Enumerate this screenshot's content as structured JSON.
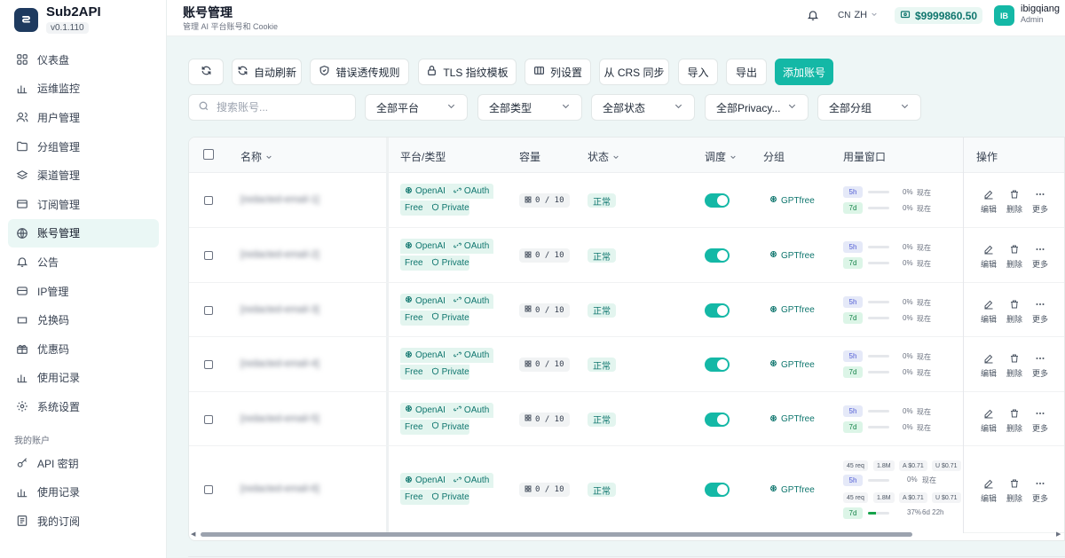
{
  "brand": {
    "name": "Sub2API",
    "version": "v0.1.110"
  },
  "nav": {
    "items": [
      {
        "label": "仪表盘",
        "icon": "grid-icon"
      },
      {
        "label": "运维监控",
        "icon": "bar-chart-icon"
      },
      {
        "label": "用户管理",
        "icon": "users-icon"
      },
      {
        "label": "分组管理",
        "icon": "folder-icon"
      },
      {
        "label": "渠道管理",
        "icon": "layers-icon"
      },
      {
        "label": "订阅管理",
        "icon": "card-icon"
      },
      {
        "label": "账号管理",
        "icon": "globe-icon",
        "active": true
      },
      {
        "label": "公告",
        "icon": "bell-icon"
      },
      {
        "label": "IP管理",
        "icon": "server-icon"
      },
      {
        "label": "兑换码",
        "icon": "ticket-icon"
      },
      {
        "label": "优惠码",
        "icon": "gift-icon"
      },
      {
        "label": "使用记录",
        "icon": "bar-chart-icon"
      },
      {
        "label": "系统设置",
        "icon": "gear-icon"
      }
    ],
    "section_label": "我的账户",
    "account_items": [
      {
        "label": "API 密钥",
        "icon": "key-icon"
      },
      {
        "label": "使用记录",
        "icon": "bar-chart-icon"
      },
      {
        "label": "我的订阅",
        "icon": "subscription-icon"
      }
    ]
  },
  "header": {
    "title": "账号管理",
    "subtitle": "管理 AI 平台账号和 Cookie",
    "lang_flag": "CN",
    "lang": "ZH",
    "balance": "$9999860.50",
    "avatar_initials": "IB",
    "username": "ibigqiang",
    "role": "Admin"
  },
  "toolbar": {
    "auto_refresh": "自动刷新",
    "error_rules": "错误透传规则",
    "tls_template": "TLS 指纹模板",
    "columns": "列设置",
    "crs_sync": "从 CRS 同步",
    "import": "导入",
    "export": "导出",
    "add_account": "添加账号"
  },
  "filters": {
    "search_placeholder": "搜索账号...",
    "platform": "全部平台",
    "type": "全部类型",
    "status": "全部状态",
    "privacy": "全部Privacy...",
    "group": "全部分组"
  },
  "table": {
    "headers": {
      "name": "名称",
      "platform_type": "平台/类型",
      "capacity": "容量",
      "status": "状态",
      "schedule": "调度",
      "group": "分组",
      "usage_window": "用量窗口",
      "actions": "操作"
    },
    "rows": [
      {
        "name": "[redacted-email-1]",
        "platform": "OpenAI",
        "auth": "OAuth",
        "plan": "Free",
        "privacy": "Private",
        "capacity": "0 / 10",
        "status": "正常",
        "scheduled": true,
        "group": "GPTfree",
        "windows": [
          {
            "label": "5h",
            "pct": "0%",
            "note": "现在",
            "fill": 0
          },
          {
            "label": "7d",
            "pct": "0%",
            "note": "现在",
            "fill": 0
          }
        ]
      },
      {
        "name": "[redacted-email-2]",
        "platform": "OpenAI",
        "auth": "OAuth",
        "plan": "Free",
        "privacy": "Private",
        "capacity": "0 / 10",
        "status": "正常",
        "scheduled": true,
        "group": "GPTfree",
        "windows": [
          {
            "label": "5h",
            "pct": "0%",
            "note": "现在",
            "fill": 0
          },
          {
            "label": "7d",
            "pct": "0%",
            "note": "现在",
            "fill": 0
          }
        ]
      },
      {
        "name": "[redacted-email-3]",
        "platform": "OpenAI",
        "auth": "OAuth",
        "plan": "Free",
        "privacy": "Private",
        "capacity": "0 / 10",
        "status": "正常",
        "scheduled": true,
        "group": "GPTfree",
        "windows": [
          {
            "label": "5h",
            "pct": "0%",
            "note": "现在",
            "fill": 0
          },
          {
            "label": "7d",
            "pct": "0%",
            "note": "现在",
            "fill": 0
          }
        ]
      },
      {
        "name": "[redacted-email-4]",
        "platform": "OpenAI",
        "auth": "OAuth",
        "plan": "Free",
        "privacy": "Private",
        "capacity": "0 / 10",
        "status": "正常",
        "scheduled": true,
        "group": "GPTfree",
        "windows": [
          {
            "label": "5h",
            "pct": "0%",
            "note": "现在",
            "fill": 0
          },
          {
            "label": "7d",
            "pct": "0%",
            "note": "现在",
            "fill": 0
          }
        ]
      },
      {
        "name": "[redacted-email-5]",
        "platform": "OpenAI",
        "auth": "OAuth",
        "plan": "Free",
        "privacy": "Private",
        "capacity": "0 / 10",
        "status": "正常",
        "scheduled": true,
        "group": "GPTfree",
        "windows": [
          {
            "label": "5h",
            "pct": "0%",
            "note": "现在",
            "fill": 0
          },
          {
            "label": "7d",
            "pct": "0%",
            "note": "现在",
            "fill": 0
          }
        ]
      },
      {
        "name": "[redacted-email-6]",
        "platform": "OpenAI",
        "auth": "OAuth",
        "plan": "Free",
        "privacy": "Private",
        "capacity": "0 / 10",
        "status": "正常",
        "scheduled": true,
        "group": "GPTfree",
        "windows": [
          {
            "label": "5h",
            "pct": "0%",
            "note": "现在",
            "fill": 0
          },
          {
            "label": "7d",
            "pct": "37%",
            "note": "6d 22h",
            "fill": 0.37
          }
        ],
        "stats": [
          {
            "req": "45 req",
            "tokens": "1.8M",
            "a": "A $0.71",
            "u": "U $0.71"
          },
          {
            "req": "45 req",
            "tokens": "1.8M",
            "a": "A $0.71",
            "u": "U $0.71"
          }
        ]
      }
    ],
    "actions": {
      "edit": "编辑",
      "delete": "删除",
      "more": "更多"
    }
  },
  "colors": {
    "accent": "#14b8a6",
    "accent_dark": "#0f766e",
    "tag_bg": "#e3f5ef"
  }
}
